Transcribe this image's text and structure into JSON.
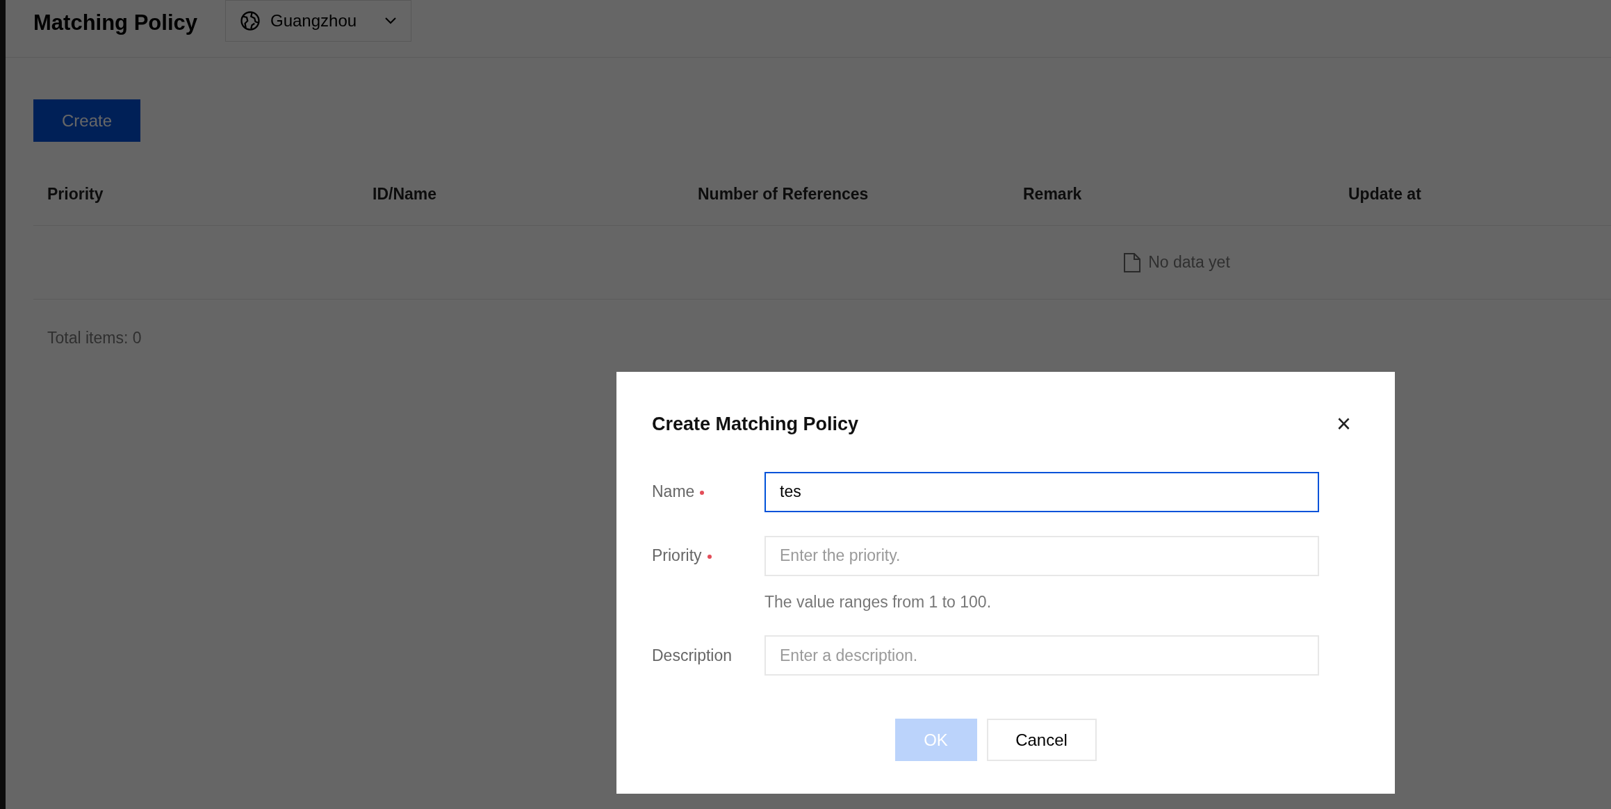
{
  "page": {
    "title": "Matching Policy",
    "region": "Guangzhou"
  },
  "toolbar": {
    "create_button": "Create"
  },
  "table": {
    "columns": [
      "Priority",
      "ID/Name",
      "Number of References",
      "Remark",
      "Update at"
    ],
    "empty_text": "No data yet",
    "total": "Total items: 0"
  },
  "dialog": {
    "title": "Create Matching Policy",
    "close": "×",
    "fields": [
      {
        "label": "Name",
        "required": true,
        "value": "tes",
        "focused": true
      },
      {
        "label": "Priority",
        "required": true,
        "placeholder": "Enter the priority.",
        "focused": false,
        "hint": "The value ranges from 1 to 100."
      },
      {
        "label": "Description",
        "required": false,
        "placeholder": "Enter a description.",
        "focused": false
      }
    ],
    "buttons": [
      {
        "label": "OK",
        "kind": "primary",
        "disabled": true
      },
      {
        "label": "Cancel",
        "kind": "secondary",
        "disabled": false
      }
    ]
  }
}
